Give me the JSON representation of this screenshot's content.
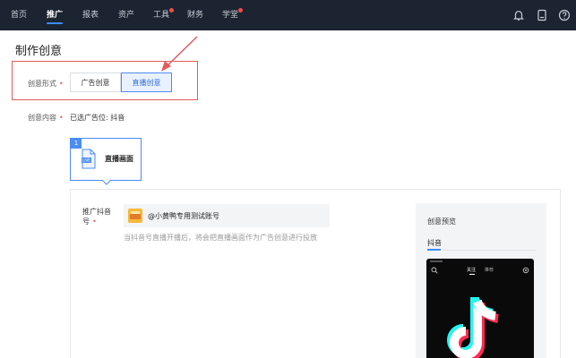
{
  "nav": {
    "items": [
      {
        "label": "首页"
      },
      {
        "label": "推广"
      },
      {
        "label": "报表"
      },
      {
        "label": "资产"
      },
      {
        "label": "工具"
      },
      {
        "label": "财务"
      },
      {
        "label": "学堂"
      }
    ],
    "active_index": 1,
    "right_icons": [
      "bell-icon",
      "tablet-icon",
      "help-icon"
    ]
  },
  "page": {
    "title": "制作创意",
    "form_label": "创意形式",
    "tab_ad": "广告创意",
    "tab_live": "直播创意",
    "content_label": "创意内容",
    "placement_label": "已选广告位:",
    "placement_value": "抖音",
    "live_card_number": "1",
    "live_card_label": "直播画面",
    "account_label": "推广抖音号",
    "account_name": "@小黄鸭专用测试账号",
    "hint": "当抖音号直播开播后，将会把直播画面作为广告创意进行投放",
    "preview_title": "创意预览",
    "preview_tab": "抖音",
    "phone_tab_follow": "关注",
    "phone_tab_recommend": "推荐"
  },
  "colors": {
    "accent": "#3b8cff",
    "nav_bg": "#1b2430",
    "annotation": "#e25b5b"
  }
}
